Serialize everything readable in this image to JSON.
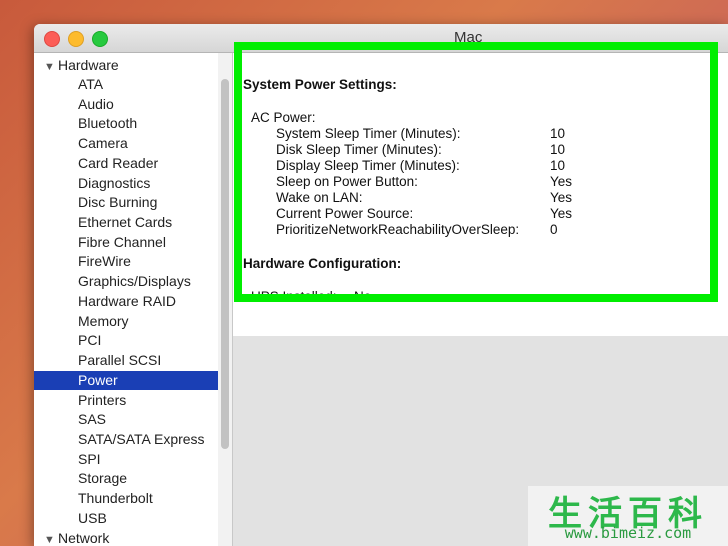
{
  "window": {
    "title": "Mac"
  },
  "sidebar": {
    "groups": [
      {
        "label": "Hardware"
      },
      {
        "label": "Network"
      }
    ],
    "items": [
      "ATA",
      "Audio",
      "Bluetooth",
      "Camera",
      "Card Reader",
      "Diagnostics",
      "Disc Burning",
      "Ethernet Cards",
      "Fibre Channel",
      "FireWire",
      "Graphics/Displays",
      "Hardware RAID",
      "Memory",
      "PCI",
      "Parallel SCSI",
      "Power",
      "Printers",
      "SAS",
      "SATA/SATA Express",
      "SPI",
      "Storage",
      "Thunderbolt",
      "USB"
    ],
    "selected": "Power"
  },
  "detail": {
    "section1_title": "System Power Settings:",
    "ac_power_label": "AC Power:",
    "rows": [
      {
        "key": "System Sleep Timer (Minutes):",
        "value": "10"
      },
      {
        "key": "Disk Sleep Timer (Minutes):",
        "value": "10"
      },
      {
        "key": "Display Sleep Timer (Minutes):",
        "value": "10"
      },
      {
        "key": "Sleep on Power Button:",
        "value": "Yes"
      },
      {
        "key": "Wake on LAN:",
        "value": "Yes"
      },
      {
        "key": "Current Power Source:",
        "value": "Yes"
      },
      {
        "key": "PrioritizeNetworkReachabilityOverSleep:",
        "value": "0"
      }
    ],
    "section2_title": "Hardware Configuration:",
    "ups_label": "UPS Installed:",
    "ups_value": "No"
  },
  "colors": {
    "highlight": "#00ee00",
    "selection": "#1a3fb5"
  },
  "watermark": {
    "big": "生活百科",
    "small": "www.bimeiz.com"
  }
}
